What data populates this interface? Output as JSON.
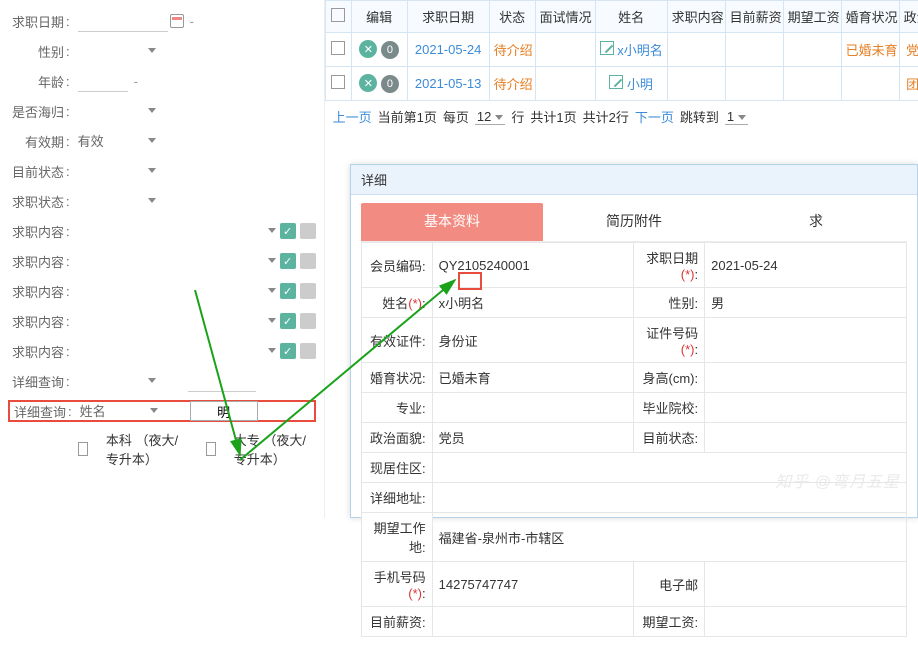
{
  "filters": {
    "apply_date": "求职日期",
    "gender": "性别",
    "age": "年龄",
    "returnee": "是否海归",
    "valid_period": "有效期",
    "valid_value": "有效",
    "current_status": "目前状态",
    "job_status": "求职状态",
    "job_content": "求职内容",
    "detail_query": "详细查询",
    "name_label": "姓名",
    "name_value": "明",
    "bachelor": "本科 （夜大/专升本）",
    "college": "大专 （夜大/专升本）"
  },
  "table": {
    "headers": [
      "",
      "编辑",
      "求职日期",
      "状态",
      "面试情况",
      "姓名",
      "求职内容",
      "目前薪资",
      "期望工资",
      "婚育状况",
      "政治面"
    ],
    "rows": [
      {
        "date": "2021-05-24",
        "status": "待介绍",
        "name": "x小明名",
        "marriage": "已婚未育",
        "party": "党员"
      },
      {
        "date": "2021-05-13",
        "status": "待介绍",
        "name": "小明",
        "marriage": "",
        "party": "团员"
      }
    ]
  },
  "pager": {
    "prev": "上一页",
    "current": "当前第1页",
    "per": "每页",
    "per_val": "12",
    "row": "行",
    "total_pages": "共计1页",
    "total_rows": "共计2行",
    "next": "下一页",
    "jump": "跳转到",
    "jump_val": "1"
  },
  "modal": {
    "title": "详细",
    "tabs": {
      "basic": "基本资料",
      "resume": "简历附件",
      "job": "求"
    },
    "fields": {
      "member_no_lbl": "会员编码",
      "member_no": "QY2105240001",
      "apply_date_lbl": "求职日期",
      "apply_date_req": "(*)",
      "apply_date": "2021-05-24",
      "name_lbl": "姓名",
      "name_req": "(*)",
      "name": "x小明名",
      "gender_lbl": "性别",
      "gender": "男",
      "id_type_lbl": "有效证件",
      "id_type": "身份证",
      "id_no_lbl": "证件号码",
      "id_no_req": "(*)",
      "marriage_lbl": "婚育状况",
      "marriage": "已婚未育",
      "height_lbl": "身高(cm)",
      "major_lbl": "专业",
      "school_lbl": "毕业院校",
      "politics_lbl": "政治面貌",
      "politics": "党员",
      "status_lbl": "目前状态",
      "address_lbl": "现居住区",
      "detail_addr_lbl": "详细地址",
      "expect_loc_lbl": "期望工作地",
      "expect_loc": "福建省-泉州市-市辖区",
      "phone_lbl": "手机号码",
      "phone_req": "(*)",
      "phone": "14275747747",
      "email_lbl": "电子邮",
      "cur_salary_lbl": "目前薪资",
      "expect_salary_lbl": "期望工资"
    }
  },
  "watermark": "知乎 @弯月五星"
}
